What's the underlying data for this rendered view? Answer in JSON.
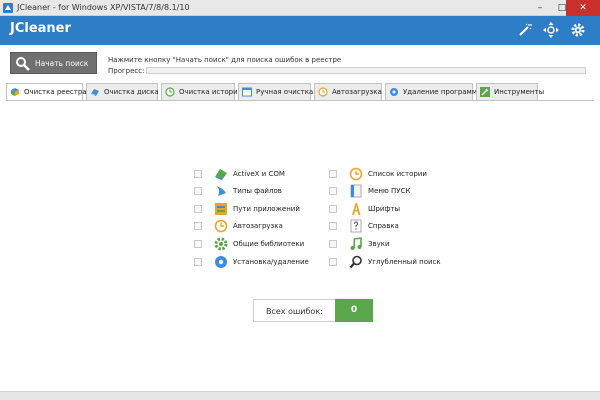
{
  "window": {
    "title": "JCleaner - for Windows XP/VISTA/7/8/8.1/10",
    "minimize": "–",
    "maximize": "□",
    "close": "✕"
  },
  "app": {
    "name": "JCleaner",
    "tools": [
      "wand-icon",
      "move-arrows-icon",
      "gear-icon"
    ],
    "accent_color": "#2d7ec6"
  },
  "search": {
    "button_label": "Начать поиск",
    "hint": "Нажмите кнопку \"Начать поиск\" для поиска ошибок в реестре",
    "progress_label": "Прогресс:",
    "progress_value": 0
  },
  "tabs": [
    {
      "label": "Очистка реестра",
      "icon": "registry-icon",
      "active": true
    },
    {
      "label": "Очистка диска",
      "icon": "disk-icon",
      "active": false
    },
    {
      "label": "Очистка истории",
      "icon": "history-icon",
      "active": false
    },
    {
      "label": "Ручная очистка",
      "icon": "window-icon",
      "active": false
    },
    {
      "label": "Автозагрузка",
      "icon": "startup-icon",
      "active": false
    },
    {
      "label": "Удаление программ",
      "icon": "uninstall-icon",
      "active": false
    },
    {
      "label": "Инструменты",
      "icon": "tools-icon",
      "active": false
    }
  ],
  "registry_items_left": [
    {
      "label": "ActiveX и COM",
      "icon": "activex-icon"
    },
    {
      "label": "Типы файлов",
      "icon": "file-types-icon"
    },
    {
      "label": "Пути приложений",
      "icon": "app-paths-icon"
    },
    {
      "label": "Автозагрузка",
      "icon": "startup-icon"
    },
    {
      "label": "Общие библиотеки",
      "icon": "shared-libraries-icon"
    },
    {
      "label": "Установка/удаление",
      "icon": "install-uninstall-icon"
    }
  ],
  "registry_items_right": [
    {
      "label": "Список истории",
      "icon": "history-list-icon"
    },
    {
      "label": "Меню ПУСК",
      "icon": "start-menu-icon"
    },
    {
      "label": "Шрифты",
      "icon": "fonts-icon"
    },
    {
      "label": "Справка",
      "icon": "help-icon"
    },
    {
      "label": "Звуки",
      "icon": "sounds-icon"
    },
    {
      "label": "Углубленный поиск",
      "icon": "deep-search-icon"
    }
  ],
  "errors": {
    "label": "Всех ошибок:",
    "value": "0",
    "color": "#5aa64a"
  }
}
